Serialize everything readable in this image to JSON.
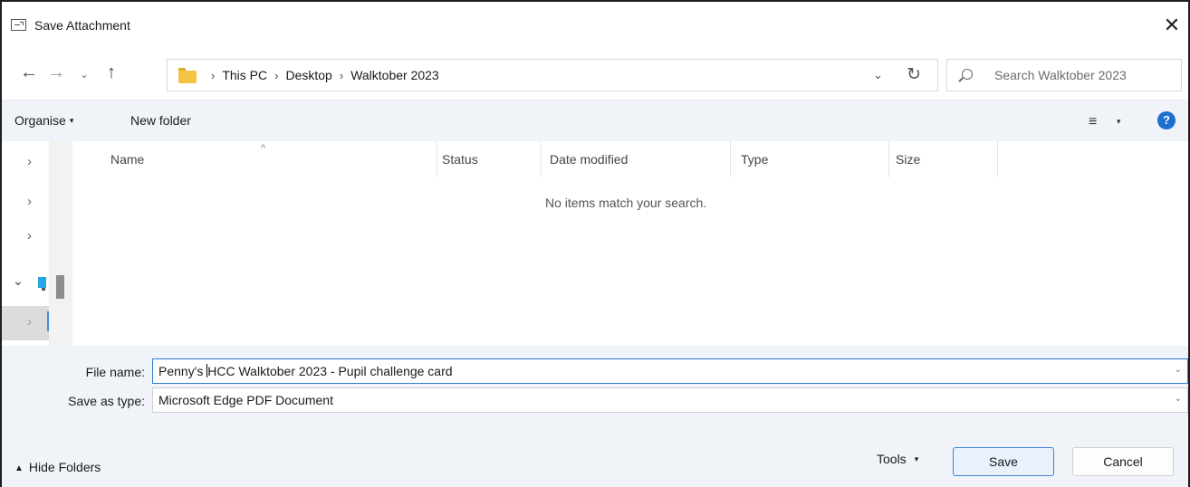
{
  "window": {
    "title": "Save Attachment",
    "close_glyph": "✕"
  },
  "nav": {
    "back_glyph": "←",
    "forward_glyph": "→",
    "recent_glyph": "⌄",
    "up_glyph": "↑",
    "breadcrumbs": [
      "This PC",
      "Desktop",
      "Walktober 2023"
    ],
    "separator": "›",
    "dropdown_glyph": "⌄",
    "refresh_glyph": "↻",
    "search_placeholder": "Search Walktober 2023"
  },
  "toolbar": {
    "organise_label": "Organise",
    "organise_caret": "▾",
    "new_folder_label": "New folder",
    "view_glyph": "≡",
    "view_caret": "▾",
    "help_glyph": "?"
  },
  "sidebar": {
    "chevron": "›",
    "expanded_chevron": "⌄"
  },
  "columns": {
    "name": "Name",
    "status": "Status",
    "date_modified": "Date modified",
    "type": "Type",
    "size": "Size",
    "sort_caret": "^"
  },
  "list": {
    "empty_message": "No items match your search."
  },
  "form": {
    "file_name_label": "File name:",
    "file_name_value_before": "Penny's ",
    "file_name_value_after": "HCC Walktober 2023 - Pupil challenge card",
    "save_type_label": "Save as type:",
    "save_type_value": "Microsoft Edge PDF Document",
    "drop_glyph": "⌄"
  },
  "footer": {
    "hide_folders_glyph": "▲",
    "hide_folders_label": "Hide Folders",
    "tools_label": "Tools",
    "tools_caret": "▾",
    "save_label": "Save",
    "cancel_label": "Cancel"
  },
  "colors": {
    "accent": "#1e6fd0",
    "panel_bg": "#f0f4f9",
    "folder": "#f4c542"
  }
}
